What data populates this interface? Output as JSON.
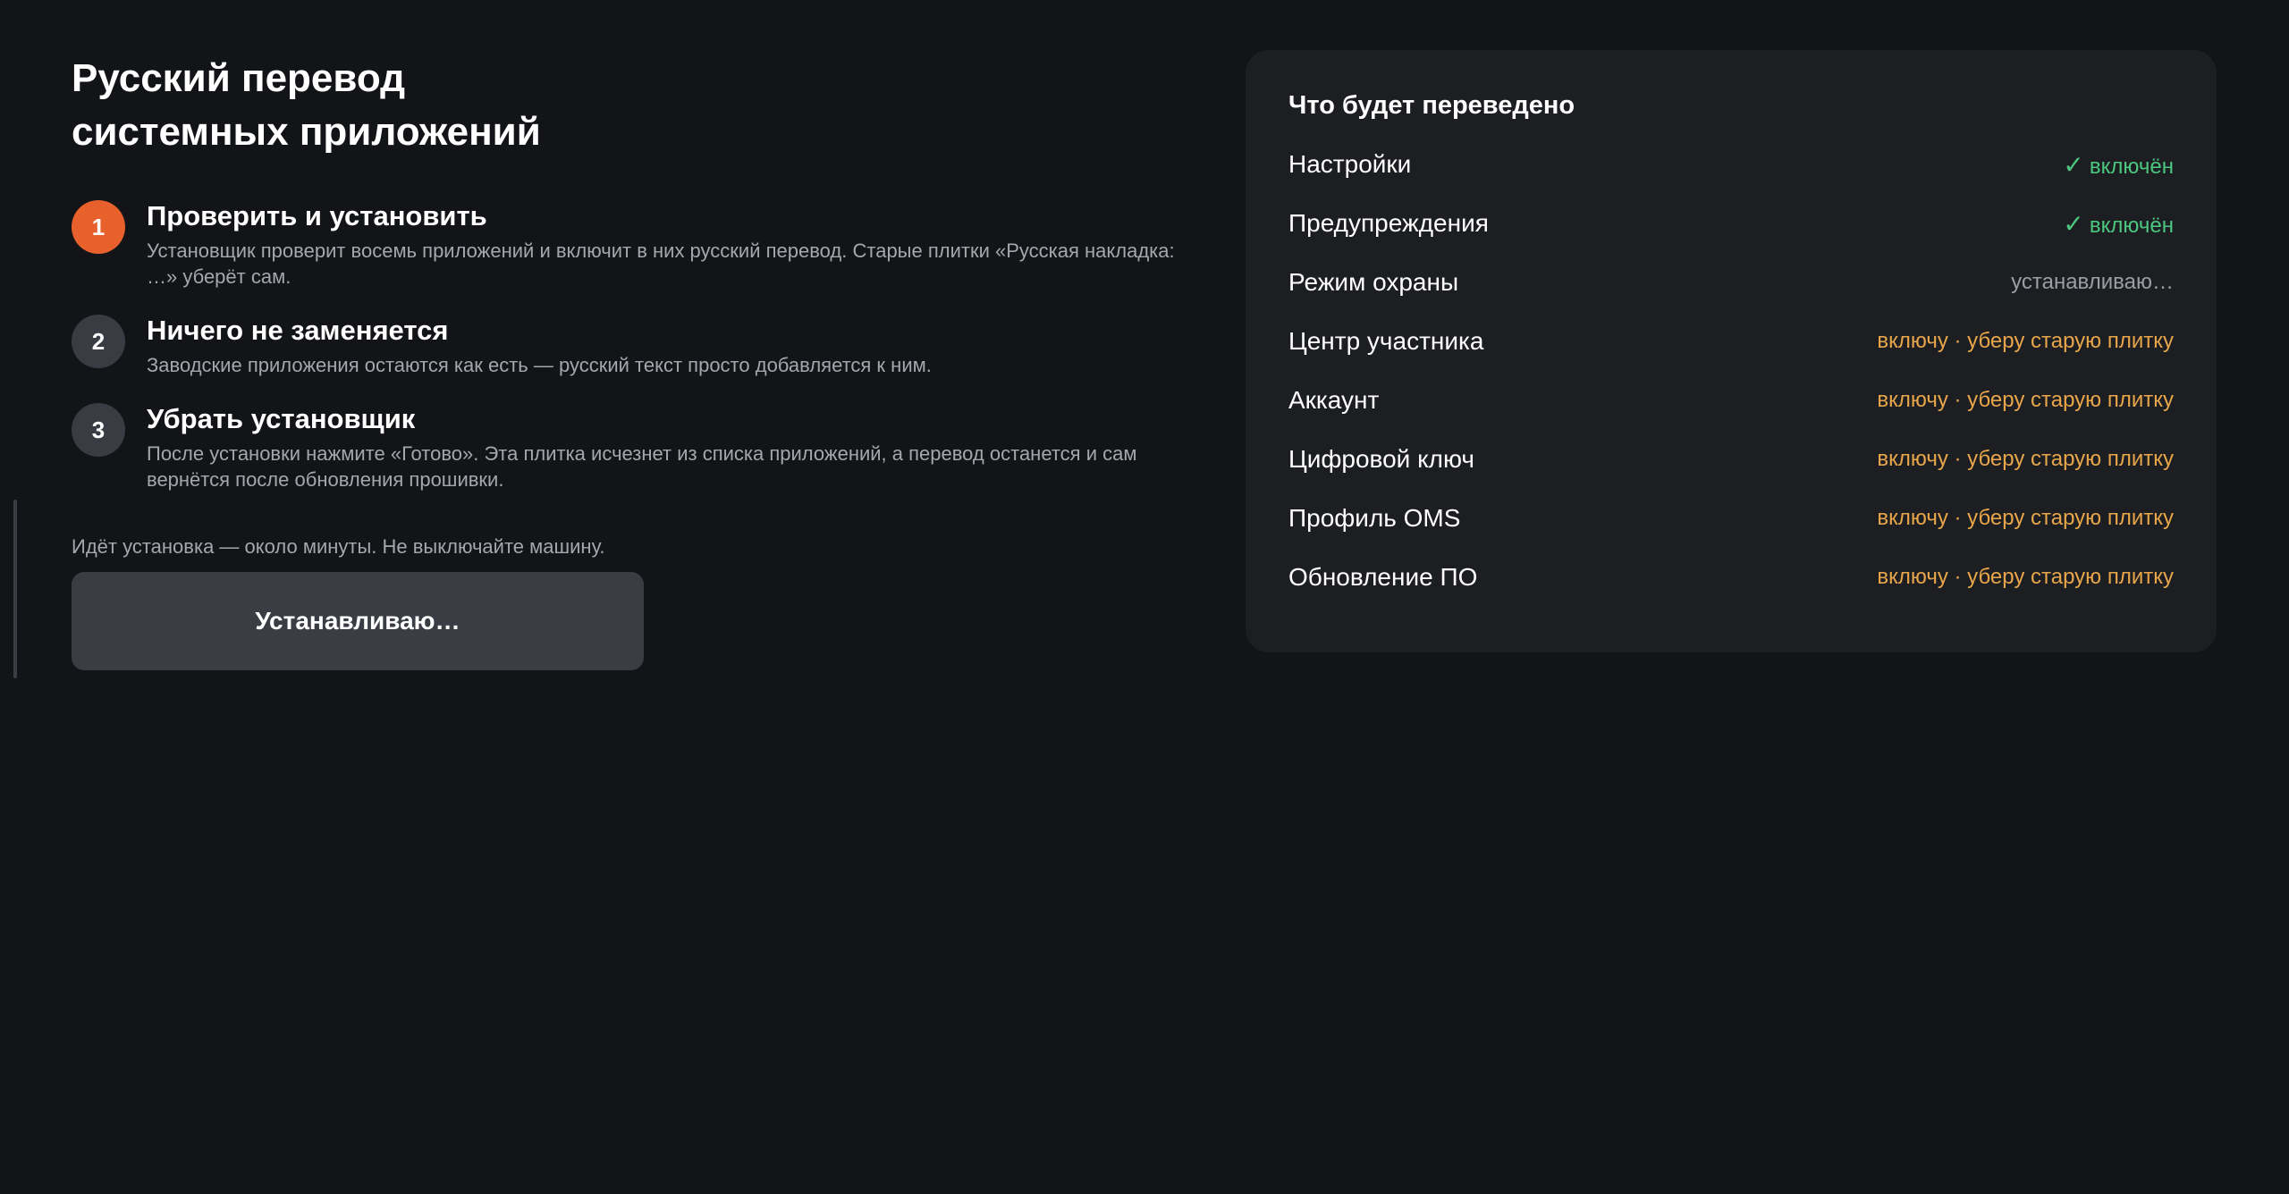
{
  "header": {
    "title_line1": "Русский перевод",
    "title_line2": "системных приложений"
  },
  "steps": [
    {
      "number": "1",
      "title": "Проверить и установить",
      "description": "Установщик проверит восемь приложений и включит в них русский перевод. Старые плитки «Русская накладка: …» уберёт сам."
    },
    {
      "number": "2",
      "title": "Ничего не заменяется",
      "description": "Заводские приложения остаются как есть — русский текст просто добавляется к ним."
    },
    {
      "number": "3",
      "title": "Убрать установщик",
      "description": "После установки нажмите «Готово». Эта плитка исчезнет из списка приложений, а перевод останется и сам вернётся после обновления прошивки."
    }
  ],
  "install": {
    "note": "Идёт установка — около минуты. Не выключайте машину.",
    "button_label": "Устанавливаю…"
  },
  "summary": {
    "title": "Что будет переведено",
    "apps": [
      {
        "name": "Настройки",
        "status": "включён",
        "icon": "✓"
      },
      {
        "name": "Предупреждения",
        "status": "включён",
        "icon": "✓"
      },
      {
        "name": "Режим охраны",
        "status": "устанавливаю…"
      },
      {
        "name": "Центр участника",
        "status": "включу · уберу старую плитку"
      },
      {
        "name": "Аккаунт",
        "status": "включу · уберу старую плитку"
      },
      {
        "name": "Цифровой ключ",
        "status": "включу · уберу старую плитку"
      },
      {
        "name": "Профиль OMS",
        "status": "включу · уберу старую плитку"
      },
      {
        "name": "Обновление ПО",
        "status": "включу · уберу старую плитку"
      }
    ]
  },
  "colors": {
    "background": "#131417",
    "card": "#1c1e22",
    "accent": "#e8612c",
    "status_done": "#4cc77f",
    "status_pending": "#9b9ea4",
    "status_todo": "#e8a64a"
  }
}
